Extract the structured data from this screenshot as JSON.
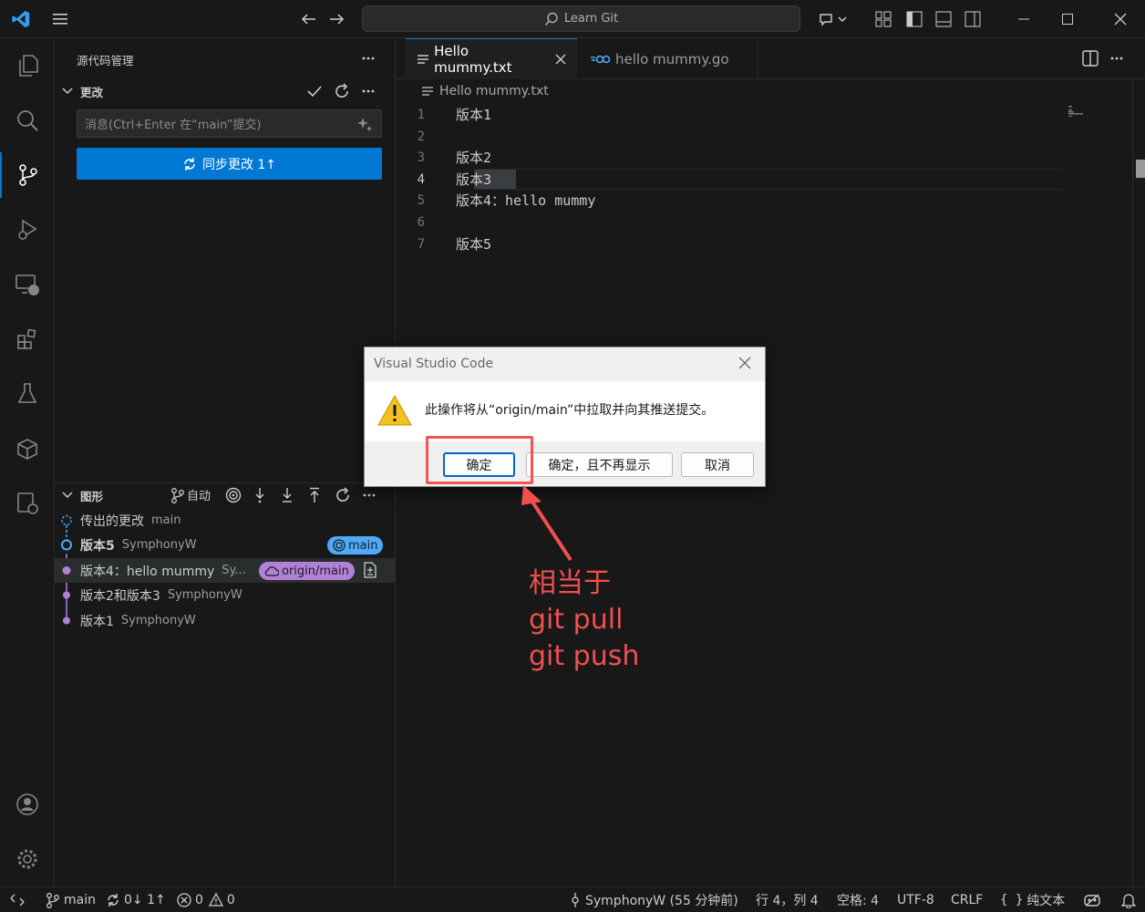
{
  "titlebar": {
    "search_text": "Learn Git"
  },
  "sidebar": {
    "title": "源代码管理",
    "changes_header": "更改",
    "message_placeholder": "消息(Ctrl+Enter 在“main”提交)",
    "sync_button": "同步更改 1↑",
    "graph_header": "图形",
    "auto_label": "自动",
    "graph_items": [
      {
        "label": "传出的更改",
        "author": "main"
      },
      {
        "label": "版本5",
        "author": "SymphonyW",
        "badge": "main"
      },
      {
        "label": "版本4：hello mummy",
        "author": "Sy...",
        "badge": "origin/main"
      },
      {
        "label": "版本2和版本3",
        "author": "SymphonyW"
      },
      {
        "label": "版本1",
        "author": "SymphonyW"
      }
    ]
  },
  "editor": {
    "tabs": [
      {
        "label": "Hello mummy.txt"
      },
      {
        "label": "hello mummy.go"
      }
    ],
    "breadcrumb": "Hello mummy.txt",
    "lines": [
      {
        "num": "1",
        "text": "版本1"
      },
      {
        "num": "2",
        "text": ""
      },
      {
        "num": "3",
        "text": "版本2"
      },
      {
        "num": "4",
        "text": "版本3"
      },
      {
        "num": "5",
        "text": "版本4：hello mummy"
      },
      {
        "num": "6",
        "text": ""
      },
      {
        "num": "7",
        "text": "版本5"
      }
    ]
  },
  "dialog": {
    "title": "Visual Studio Code",
    "message": "此操作将从“origin/main”中拉取并向其推送提交。",
    "ok": "确定",
    "ok_dont_show": "确定，且不再显示",
    "cancel": "取消"
  },
  "annotation": {
    "line1": "相当于",
    "line2": "git pull",
    "line3": "git push"
  },
  "statusbar": {
    "branch": "main",
    "sync": "0↓ 1↑",
    "errors": "0",
    "warnings": "0",
    "blame": "SymphonyW (55 分钟前)",
    "position": "行 4，列 4",
    "spaces": "空格: 4",
    "encoding": "UTF-8",
    "eol": "CRLF",
    "language": "纯文本"
  },
  "colors": {
    "accent": "#0078d4",
    "annotation": "#f04f4f",
    "graph_purple": "#b180d7",
    "graph_blue": "#4daafc"
  }
}
